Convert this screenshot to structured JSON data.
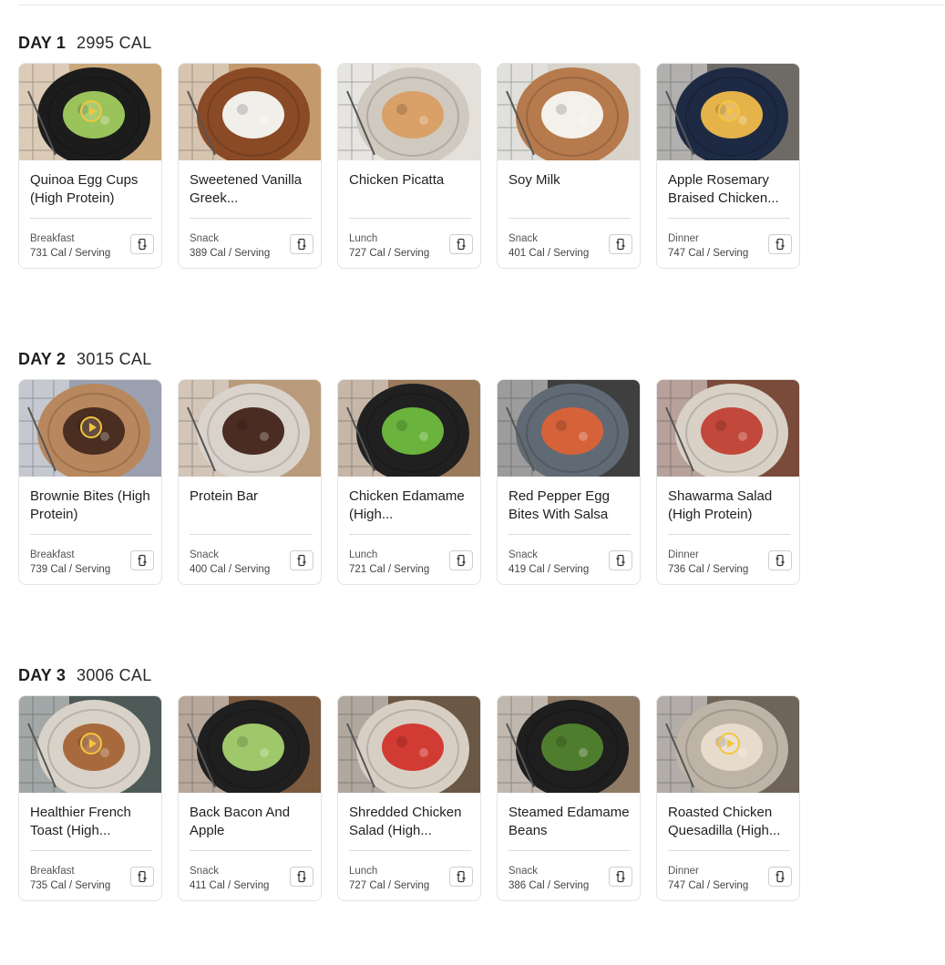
{
  "days": [
    {
      "label": "DAY 1",
      "calories": "2995 CAL",
      "meals": [
        {
          "title": "Quinoa Egg Cups (High Protein)",
          "type": "Breakfast",
          "cal": "731 Cal / Serving",
          "video": true,
          "plate": "#1c1c1c",
          "food": "#9bc35b",
          "bg": "#c9a77a"
        },
        {
          "title": "Sweetened Vanilla Greek...",
          "type": "Snack",
          "cal": "389 Cal / Serving",
          "video": false,
          "plate": "#8a4a26",
          "food": "#f1efea",
          "bg": "#c49a6c"
        },
        {
          "title": "Chicken Picatta",
          "type": "Lunch",
          "cal": "727 Cal / Serving",
          "video": false,
          "plate": "#cfc9bf",
          "food": "#d9a067",
          "bg": "#e4e0da"
        },
        {
          "title": "Soy Milk",
          "type": "Snack",
          "cal": "401 Cal / Serving",
          "video": false,
          "plate": "#b67a4c",
          "food": "#f4f1ea",
          "bg": "#d8d4cc"
        },
        {
          "title": "Apple Rosemary Braised Chicken...",
          "type": "Dinner",
          "cal": "747 Cal / Serving",
          "video": true,
          "plate": "#1e2a44",
          "food": "#e6b24a",
          "bg": "#6e6a66"
        }
      ]
    },
    {
      "label": "DAY 2",
      "calories": "3015 CAL",
      "meals": [
        {
          "title": "Brownie Bites (High Protein)",
          "type": "Breakfast",
          "cal": "739 Cal / Serving",
          "video": true,
          "plate": "#b8875d",
          "food": "#4a2e22",
          "bg": "#9aa0b0"
        },
        {
          "title": "Protein Bar",
          "type": "Snack",
          "cal": "400 Cal / Serving",
          "video": false,
          "plate": "#d9d3cb",
          "food": "#4b2c22",
          "bg": "#b99a7b"
        },
        {
          "title": "Chicken Edamame (High...",
          "type": "Lunch",
          "cal": "721 Cal / Serving",
          "video": false,
          "plate": "#202020",
          "food": "#6ab33c",
          "bg": "#9b7a5b"
        },
        {
          "title": "Red Pepper Egg Bites With Salsa",
          "type": "Snack",
          "cal": "419 Cal / Serving",
          "video": false,
          "plate": "#606a74",
          "food": "#d6623a",
          "bg": "#3f3f3f"
        },
        {
          "title": "Shawarma Salad (High Protein)",
          "type": "Dinner",
          "cal": "736 Cal / Serving",
          "video": false,
          "plate": "#d9d1c6",
          "food": "#c3483c",
          "bg": "#7a4b3a"
        }
      ]
    },
    {
      "label": "DAY 3",
      "calories": "3006 CAL",
      "meals": [
        {
          "title": "Healthier French Toast (High...",
          "type": "Breakfast",
          "cal": "735 Cal / Serving",
          "video": true,
          "plate": "#d8d2c8",
          "food": "#a86a3d",
          "bg": "#4d5a57"
        },
        {
          "title": "Back Bacon And Apple",
          "type": "Snack",
          "cal": "411 Cal / Serving",
          "video": false,
          "plate": "#1f1f1f",
          "food": "#9fc86a",
          "bg": "#7d5a3e"
        },
        {
          "title": "Shredded Chicken Salad (High...",
          "type": "Lunch",
          "cal": "727 Cal / Serving",
          "video": false,
          "plate": "#d8cfc4",
          "food": "#d23b33",
          "bg": "#6a5844"
        },
        {
          "title": "Steamed Edamame Beans",
          "type": "Snack",
          "cal": "386 Cal / Serving",
          "video": false,
          "plate": "#1e1e1e",
          "food": "#4f7d2e",
          "bg": "#8f7a66"
        },
        {
          "title": "Roasted Chicken Quesadilla (High...",
          "type": "Dinner",
          "cal": "747 Cal / Serving",
          "video": true,
          "plate": "#bdb3a6",
          "food": "#e7dccb",
          "bg": "#6f6459"
        }
      ]
    }
  ]
}
